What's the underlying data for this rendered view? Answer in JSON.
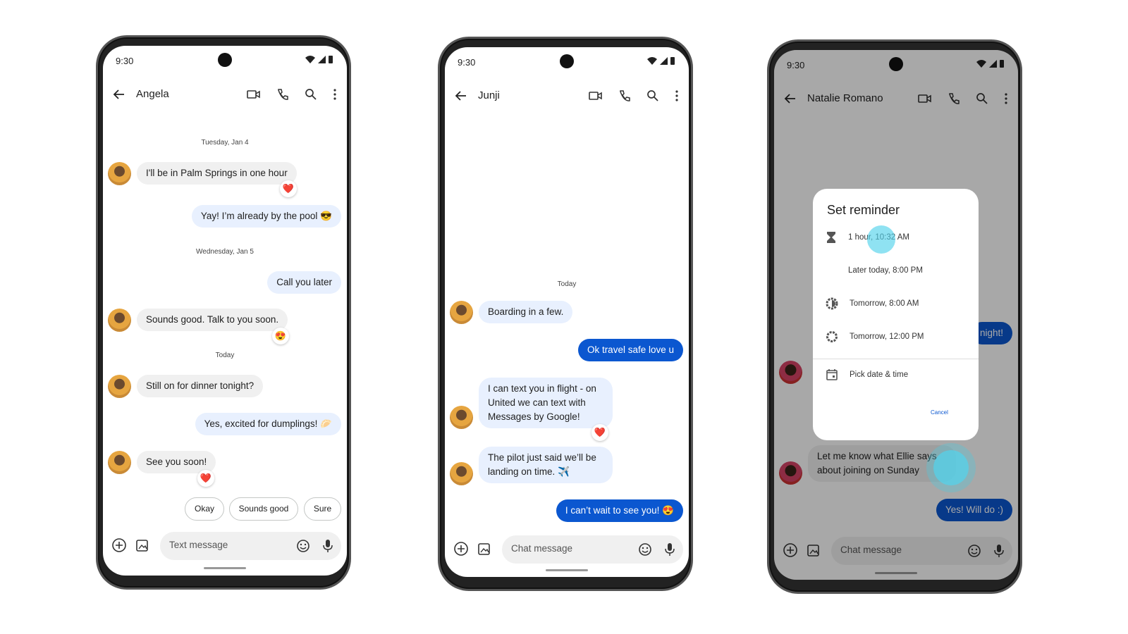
{
  "status_time": "9:30",
  "phones": [
    {
      "contact": "Angela",
      "dates": [
        "Tuesday, Jan 4",
        "Wednesday, Jan 5",
        "Today"
      ],
      "messages": [
        {
          "dir": "in",
          "text": "I'll be in Palm Springs in one hour",
          "reaction": "❤️"
        },
        {
          "dir": "out",
          "text": "Yay! I’m already by the pool 😎"
        },
        {
          "dir": "out",
          "text": "Call you later"
        },
        {
          "dir": "in",
          "text": "Sounds good. Talk to you soon.",
          "reaction": "😍"
        },
        {
          "dir": "in",
          "text": "Still on for dinner tonight?"
        },
        {
          "dir": "out",
          "text": "Yes, excited for dumplings! 🥟"
        },
        {
          "dir": "in",
          "text": "See you soon!",
          "reaction": "❤️"
        }
      ],
      "smart_replies": [
        "Okay",
        "Sounds good",
        "Sure"
      ],
      "input_placeholder": "Text message"
    },
    {
      "contact": "Junji",
      "dates": [
        "Today"
      ],
      "messages": [
        {
          "dir": "in",
          "text": "Boarding in a few."
        },
        {
          "dir": "out",
          "text": "Ok travel safe love u"
        },
        {
          "dir": "in",
          "text": "I can text you in flight - on United we can text with Messages by Google!",
          "reaction": "❤️"
        },
        {
          "dir": "in",
          "text": "The pilot just said we’ll be landing on time. ✈️"
        },
        {
          "dir": "out",
          "text": "I can’t wait to see you! 😍"
        }
      ],
      "input_placeholder": "Chat message"
    },
    {
      "contact": "Natalie Romano",
      "messages": [
        {
          "dir": "out",
          "text": "night!"
        },
        {
          "dir": "in",
          "text": "Let me know what Ellie says about joining on Sunday"
        },
        {
          "dir": "out",
          "text": "Yes! Will do :)"
        }
      ],
      "input_placeholder": "Chat message",
      "dialog": {
        "title": "Set reminder",
        "options": [
          {
            "icon": "hourglass-icon",
            "label": "1 hour, 10:32 AM"
          },
          {
            "icon": "moon-icon",
            "label": "Later today, 8:00 PM"
          },
          {
            "icon": "brightness-icon",
            "label": "Tomorrow, 8:00 AM"
          },
          {
            "icon": "sun-icon",
            "label": "Tomorrow, 12:00 PM"
          },
          {
            "icon": "calendar-icon",
            "label": "Pick date & time"
          }
        ],
        "cancel": "Cancel"
      }
    }
  ],
  "colors": {
    "accent": "#0b57d0",
    "outgoing_bubble": "#e8f0fe",
    "incoming_bubble": "#f0f0f0"
  }
}
